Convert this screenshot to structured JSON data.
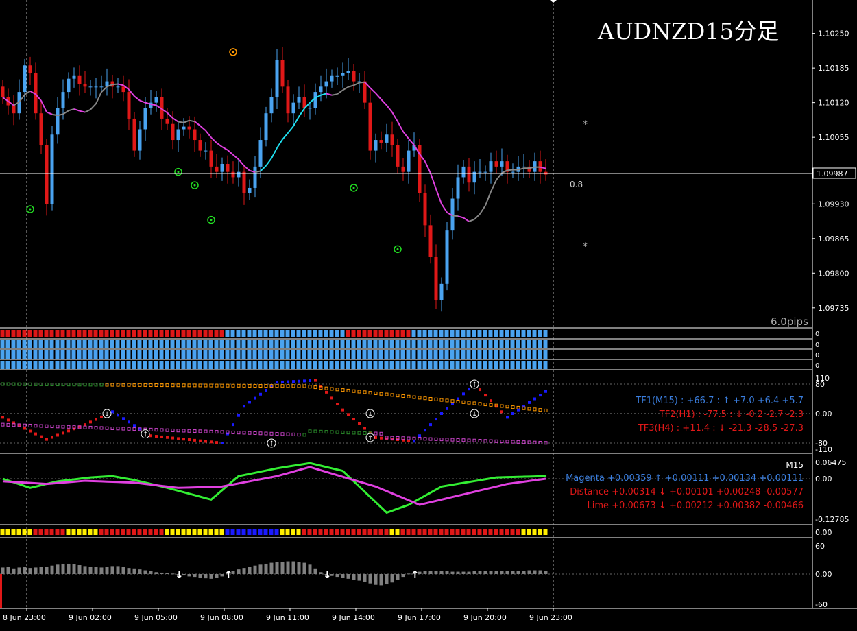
{
  "title": "AUDNZD15分足",
  "colors": {
    "bull": "#4aa3f0",
    "bear": "#e01818",
    "ma_gray": "#888888",
    "ma_magenta": "#e040e0",
    "ma_cyan": "#20e0f0",
    "bg": "#000000",
    "fg": "#ffffff",
    "green": "#22dd22",
    "orange": "#ff9900",
    "yellow": "#ffee00",
    "blue": "#1a1aff",
    "red": "#e01818",
    "purple": "#cc44cc",
    "olive": "#2a8a2a"
  },
  "price_axis": {
    "labels": [
      "1.10250",
      "1.10185",
      "1.10120",
      "1.10055",
      "1.09990",
      "1.09930",
      "1.09865",
      "1.09800",
      "1.09735"
    ],
    "current": "1.09987",
    "range": [
      1.097,
      1.1031
    ]
  },
  "annotations": {
    "spread": "0.8",
    "pips": "6.0pips"
  },
  "time_axis": [
    "8 Jun 23:00",
    "9 Jun 02:00",
    "9 Jun 05:00",
    "9 Jun 08:00",
    "9 Jun 11:00",
    "9 Jun 14:00",
    "9 Jun 17:00",
    "9 Jun 20:00",
    "9 Jun 23:00"
  ],
  "strips": {
    "zero_labels": [
      "0",
      "0",
      "0",
      "0"
    ],
    "rows": [
      {
        "segments": [
          {
            "color": "#e01818",
            "count": 41
          },
          {
            "color": "#4aa3f0",
            "count": 22
          },
          {
            "color": "#e01818",
            "count": 12
          },
          {
            "color": "#4aa3f0",
            "count": 25
          }
        ]
      },
      {
        "segments": [
          {
            "color": "#4aa3f0",
            "count": 100
          }
        ]
      },
      {
        "segments": [
          {
            "color": "#4aa3f0",
            "count": 100
          }
        ]
      },
      {
        "segments": [
          {
            "color": "#4aa3f0",
            "count": 100
          }
        ]
      },
      {
        "segments": [
          {
            "color": "#4aa3f0",
            "count": 100
          }
        ]
      }
    ]
  },
  "tf_panel": {
    "axis_labels": [
      "110",
      "80",
      "0.00",
      "-80",
      "-110"
    ],
    "lines": [
      {
        "text": "TF1(M15) : +66.7 : ↑ +7.0 +6.4 +5.7",
        "color": "#3b7fe0"
      },
      {
        "text": "TF2(H1) : -77.5 : ↓ -0.2 -2.7 -2.3",
        "color": "#e01818"
      },
      {
        "text": "TF3(H4) : +11.4 : ↓ -21.3 -28.5 -27.3",
        "color": "#e01818"
      }
    ]
  },
  "ma_panel": {
    "timeframe": "M15",
    "axis_labels": [
      "0.06475",
      "0.00",
      "-0.12785"
    ],
    "lines": [
      {
        "text": "Magenta +0.00359 ↑ +0.00111 +0.00134 +0.00111",
        "color": "#3b7fe0"
      },
      {
        "text": "Distance +0.00314 ↓ +0.00101 +0.00248 -0.00577",
        "color": "#e01818"
      },
      {
        "text": "Lime +0.00673 ↓ +0.00212 +0.00382 -0.00466",
        "color": "#e01818"
      }
    ]
  },
  "color_strip": {
    "label": "0.00",
    "segments": [
      {
        "color": "#ffee00",
        "count": 6
      },
      {
        "color": "#e01818",
        "count": 6
      },
      {
        "color": "#ffee00",
        "count": 6
      },
      {
        "color": "#e01818",
        "count": 12
      },
      {
        "color": "#ffee00",
        "count": 11
      },
      {
        "color": "#1a1aff",
        "count": 10
      },
      {
        "color": "#ffee00",
        "count": 4
      },
      {
        "color": "#e01818",
        "count": 16
      },
      {
        "color": "#ffee00",
        "count": 2
      },
      {
        "color": "#e01818",
        "count": 22
      },
      {
        "color": "#ffee00",
        "count": 5
      }
    ]
  },
  "histogram": {
    "axis_labels": [
      "60",
      "0.00",
      "-60"
    ],
    "range": [
      -60,
      60
    ],
    "values": [
      14,
      16,
      12,
      14,
      15,
      13,
      14,
      15,
      16,
      18,
      20,
      22,
      22,
      21,
      19,
      17,
      16,
      15,
      14,
      16,
      17,
      17,
      15,
      13,
      12,
      10,
      8,
      6,
      4,
      3,
      2,
      1,
      -1,
      -3,
      -5,
      -6,
      -8,
      -9,
      -10,
      -8,
      -5,
      2,
      6,
      10,
      13,
      16,
      18,
      20,
      22,
      24,
      26,
      26,
      27,
      27,
      26,
      24,
      20,
      12,
      4,
      -2,
      -4,
      -6,
      -8,
      -10,
      -12,
      -14,
      -17,
      -20,
      -23,
      -24,
      -22,
      -18,
      -12,
      -6,
      1,
      3,
      5,
      6,
      7,
      7,
      7,
      6,
      5,
      5,
      5,
      5,
      6,
      6,
      6,
      6,
      7,
      7,
      7,
      7,
      7,
      7,
      8,
      8,
      8,
      7
    ]
  },
  "chart_data": [
    {
      "type": "candlestick",
      "title": "AUDNZD15分足",
      "ylim": [
        1.097,
        1.1031
      ],
      "x_ticks": [
        "8 Jun 23:00",
        "9 Jun 02:00",
        "9 Jun 05:00",
        "9 Jun 08:00",
        "9 Jun 11:00",
        "9 Jun 14:00",
        "9 Jun 17:00",
        "9 Jun 20:00",
        "9 Jun 23:00"
      ],
      "current_price": 1.09987,
      "candles_close": [
        1.1013,
        1.10115,
        1.101,
        1.1014,
        1.1019,
        1.10175,
        1.101,
        1.1004,
        1.0993,
        1.1006,
        1.1011,
        1.1014,
        1.10165,
        1.1017,
        1.10155,
        1.1015,
        1.1015,
        1.1015,
        1.1015,
        1.1016,
        1.1015,
        1.1015,
        1.1014,
        1.1009,
        1.1003,
        1.1007,
        1.1011,
        1.1012,
        1.1013,
        1.1009,
        1.1008,
        1.1005,
        1.1007,
        1.10075,
        1.1007,
        1.1005,
        1.1003,
        1.1003,
        1.1,
        1.0999,
        1.10005,
        1.0999,
        1.0998,
        1.0999,
        1.0995,
        1.0996,
        1.1,
        1.1005,
        1.101,
        1.1013,
        1.102,
        1.1015,
        1.101,
        1.1012,
        1.1013,
        1.1011,
        1.1011,
        1.1014,
        1.1015,
        1.1016,
        1.1017,
        1.1017,
        1.10175,
        1.1018,
        1.1016,
        1.1016,
        1.1012,
        1.1003,
        1.1005,
        1.10045,
        1.1006,
        1.1004,
        1.1,
        1.0999,
        1.1003,
        1.1004,
        1.0995,
        1.0989,
        1.0983,
        1.0975,
        1.0978,
        1.0988,
        1.0994,
        1.0998,
        1.1,
        1.0997,
        1.0999,
        1.0999,
        1.0999,
        1.1001,
        1.1,
        1.1001,
        1.0999,
        1.0999,
        1.1,
        1.1,
        1.0999,
        1.1001,
        1.0999,
        1.09985
      ]
    },
    {
      "type": "line",
      "title": "TF1(M15)",
      "ylim": [
        -110,
        110
      ]
    },
    {
      "type": "line",
      "title": "M15",
      "ylim": [
        -0.12785,
        0.06475
      ]
    },
    {
      "type": "bar",
      "title": "histogram",
      "ylim": [
        -60,
        60
      ]
    }
  ]
}
